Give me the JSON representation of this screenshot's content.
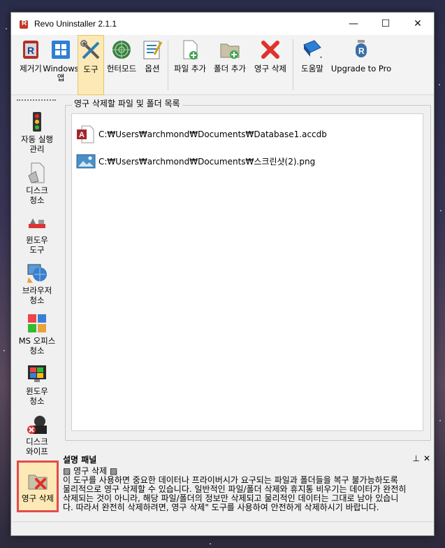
{
  "window": {
    "title": "Revo Uninstaller 2.1.1",
    "minimize": "—",
    "maximize": "☐",
    "close": "✕"
  },
  "toolbar": {
    "items": [
      {
        "label": "제거기",
        "icon": "uninstaller-icon"
      },
      {
        "label": "Windows\n앱",
        "icon": "windows-apps-icon"
      },
      {
        "label": "도구",
        "icon": "tools-icon",
        "active": true
      },
      {
        "label": "헌터모드",
        "icon": "hunter-mode-icon"
      },
      {
        "label": "옵션",
        "icon": "options-icon"
      },
      {
        "label": "파일 추가",
        "icon": "add-file-icon"
      },
      {
        "label": "폴더 추가",
        "icon": "add-folder-icon"
      },
      {
        "label": "영구 삭제",
        "icon": "delete-icon"
      },
      {
        "label": "도움말",
        "icon": "help-icon"
      },
      {
        "label": "Upgrade to Pro",
        "icon": "upgrade-icon"
      }
    ]
  },
  "sidebar": {
    "items": [
      {
        "label": "자동 실행\n관리",
        "icon": "traffic-light-icon"
      },
      {
        "label": "디스크\n청소",
        "icon": "disk-cleaner-icon"
      },
      {
        "label": "윈도우\n도구",
        "icon": "windows-tools-icon"
      },
      {
        "label": "브라우저\n청소",
        "icon": "browser-cleaner-icon"
      },
      {
        "label": "MS 오피스\n청소",
        "icon": "office-cleaner-icon"
      },
      {
        "label": "윈도우\n청소",
        "icon": "windows-cleaner-icon"
      },
      {
        "label": "디스크\n와이프",
        "icon": "disk-wipe-icon"
      },
      {
        "label": "영구 삭제",
        "icon": "permanent-delete-icon",
        "selected": true
      }
    ]
  },
  "main": {
    "group_label": "영구 삭제할 파일 및 폴더 목록",
    "files": [
      {
        "path": "C:₩Users₩archmond₩Documents₩Database1.accdb",
        "icon": "access-file-icon"
      },
      {
        "path": "C:₩Users₩archmond₩Documents₩스크린샷(2).png",
        "icon": "image-file-icon"
      }
    ]
  },
  "description": {
    "title": "설명 패널",
    "pin": "⊥",
    "close": "✕",
    "heading": "▨ 영구 삭제 ▨",
    "lines": [
      "이 도구를 사용하면 중요한 데이터나 프라이버시가 요구되는 파일과 폴더들을 복구 불가능하도록",
      "물리적으로 영구 삭제할 수 있습니다. 일반적인 파일/폴더 삭제와 휴지통 비우기는 데이터가 완전히",
      "삭제되는 것이 아니라, 해당 파일/폴더의 정보만 삭제되고 물리적인 데이터는 그대로 남아 있습니",
      "다. 따라서 완전히 삭제하려면, 영구 삭제\" 도구를 사용하여 안전하게 삭제하시기 바랍니다."
    ]
  },
  "colors": {
    "active_bg": "#fce9b6",
    "selected_border": "#e54b4b"
  }
}
